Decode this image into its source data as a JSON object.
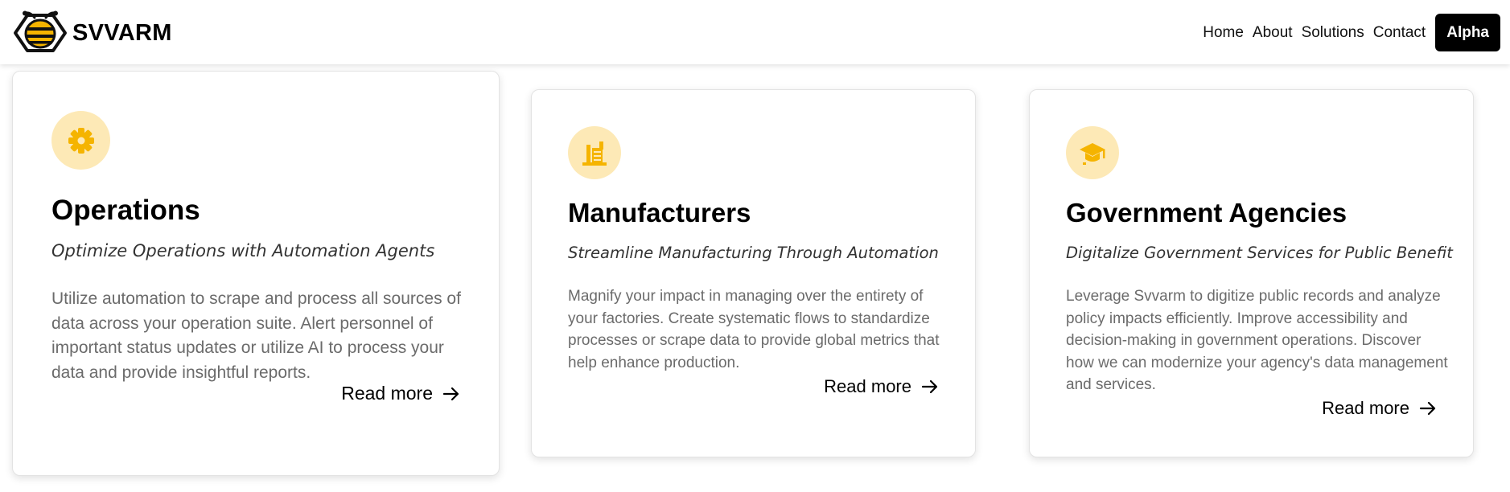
{
  "brand": {
    "name": "SVVARM",
    "logo_icon": "bee-icon"
  },
  "nav": {
    "links": [
      "Home",
      "About",
      "Solutions",
      "Contact"
    ],
    "cta_label": "Alpha"
  },
  "colors": {
    "accent": "#f5b400",
    "icon_background": "#fde9b6",
    "button_background": "#000000",
    "body_text": "#6b6b6b"
  },
  "cards": [
    {
      "icon": "gear-icon",
      "title": "Operations",
      "subtitle": "Optimize Operations with Automation Agents",
      "description": "Utilize automation to scrape and process all sources of data across your operation suite. Alert personnel of important status updates or utilize AI to process your data and provide insightful reports.",
      "link_label": "Read more"
    },
    {
      "icon": "factory-icon",
      "title": "Manufacturers",
      "subtitle": "Streamline Manufacturing Through Automation",
      "description": "Magnify your impact in managing over the entirety of your factories. Create systematic flows to standardize processes or scrape data to provide global metrics that help enhance production.",
      "link_label": "Read more"
    },
    {
      "icon": "graduation-cap-icon",
      "title": "Government Agencies",
      "subtitle": "Digitalize Government Services for Public Benefit",
      "description": "Leverage Svvarm to digitize public records and analyze policy impacts efficiently. Improve accessibility and decision-making in government operations. Discover how we can modernize your agency's data management and services.",
      "link_label": "Read more"
    }
  ]
}
